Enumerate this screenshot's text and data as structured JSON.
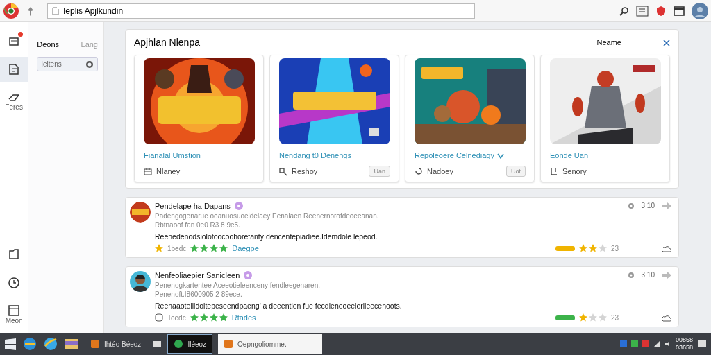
{
  "toolbar": {
    "address": "Ieplis Apjlkundin"
  },
  "rail": {
    "items": [
      {
        "kind": "inbox",
        "badge": true,
        "selected": false
      },
      {
        "kind": "doc",
        "badge": false,
        "selected": true
      },
      {
        "kind": "link",
        "label": "Feres",
        "badge": false,
        "selected": false
      }
    ],
    "bottom": [
      {
        "kind": "folder"
      },
      {
        "kind": "clock"
      },
      {
        "kind": "calendar",
        "label": "Meon"
      }
    ]
  },
  "panel": {
    "title": "Deons",
    "action": "Lang",
    "search": {
      "value": "Ieitens"
    }
  },
  "featured": {
    "title": "Apjhlan Nlenpa",
    "sort": "Neame",
    "games": [
      {
        "title": "Fianalal Umstion",
        "meta": "Nlaney",
        "verified": false
      },
      {
        "title": "Nendang t0 Denengs",
        "meta": "Reshoy",
        "button": "Uan",
        "verified": false
      },
      {
        "title": "Repoleoere Celnediagy",
        "meta": "Nadoey",
        "button": "Uot",
        "verified": true
      },
      {
        "title": "Eonde Uan",
        "meta": "Senory",
        "verified": false
      }
    ]
  },
  "reviews": [
    {
      "name": "Pendelape ha Dapans",
      "line1": "Padengogenarue ooanuosuoeldeiaey Eenaiaen  Reenernorofdeoeeanan.",
      "line2": "Rbtnaoof fan 0e0 R3 8 9e5.",
      "body": "Reenedenodsiolofoocoohoretanty dencentepiadiee.Idemdole lepeod.",
      "badge": "1bedc",
      "stars": 4,
      "link": "Daegpe",
      "count": "3 10",
      "meter": {
        "color": "#f0b400",
        "stars": 2
      },
      "votes": "23"
    },
    {
      "name": "Nenfeoliaepier Sanicleen",
      "line1": "Penenogkartentee Aceeotieleenceny fendleegenaren.",
      "line2": "Penenoft.I8600905 2 89ece.",
      "body": "Reenaaotelildoitepeseendpaeng' a deeentien fue fecdieneoeelerileecenoots.",
      "badge": "Toedc",
      "stars": 4,
      "link": "Rtades",
      "count": "3 10",
      "meter": {
        "color": "#3cb34a",
        "stars": 1
      },
      "votes": "23"
    }
  ],
  "taskbar": {
    "tasks": [
      {
        "label": "Ihtéo Béeoz",
        "selected": false
      },
      {
        "label": "Iléeoz",
        "selected": true
      },
      {
        "label": "Oepngoliomme.",
        "selected": false
      }
    ],
    "clock": [
      "00858",
      "03658"
    ]
  }
}
